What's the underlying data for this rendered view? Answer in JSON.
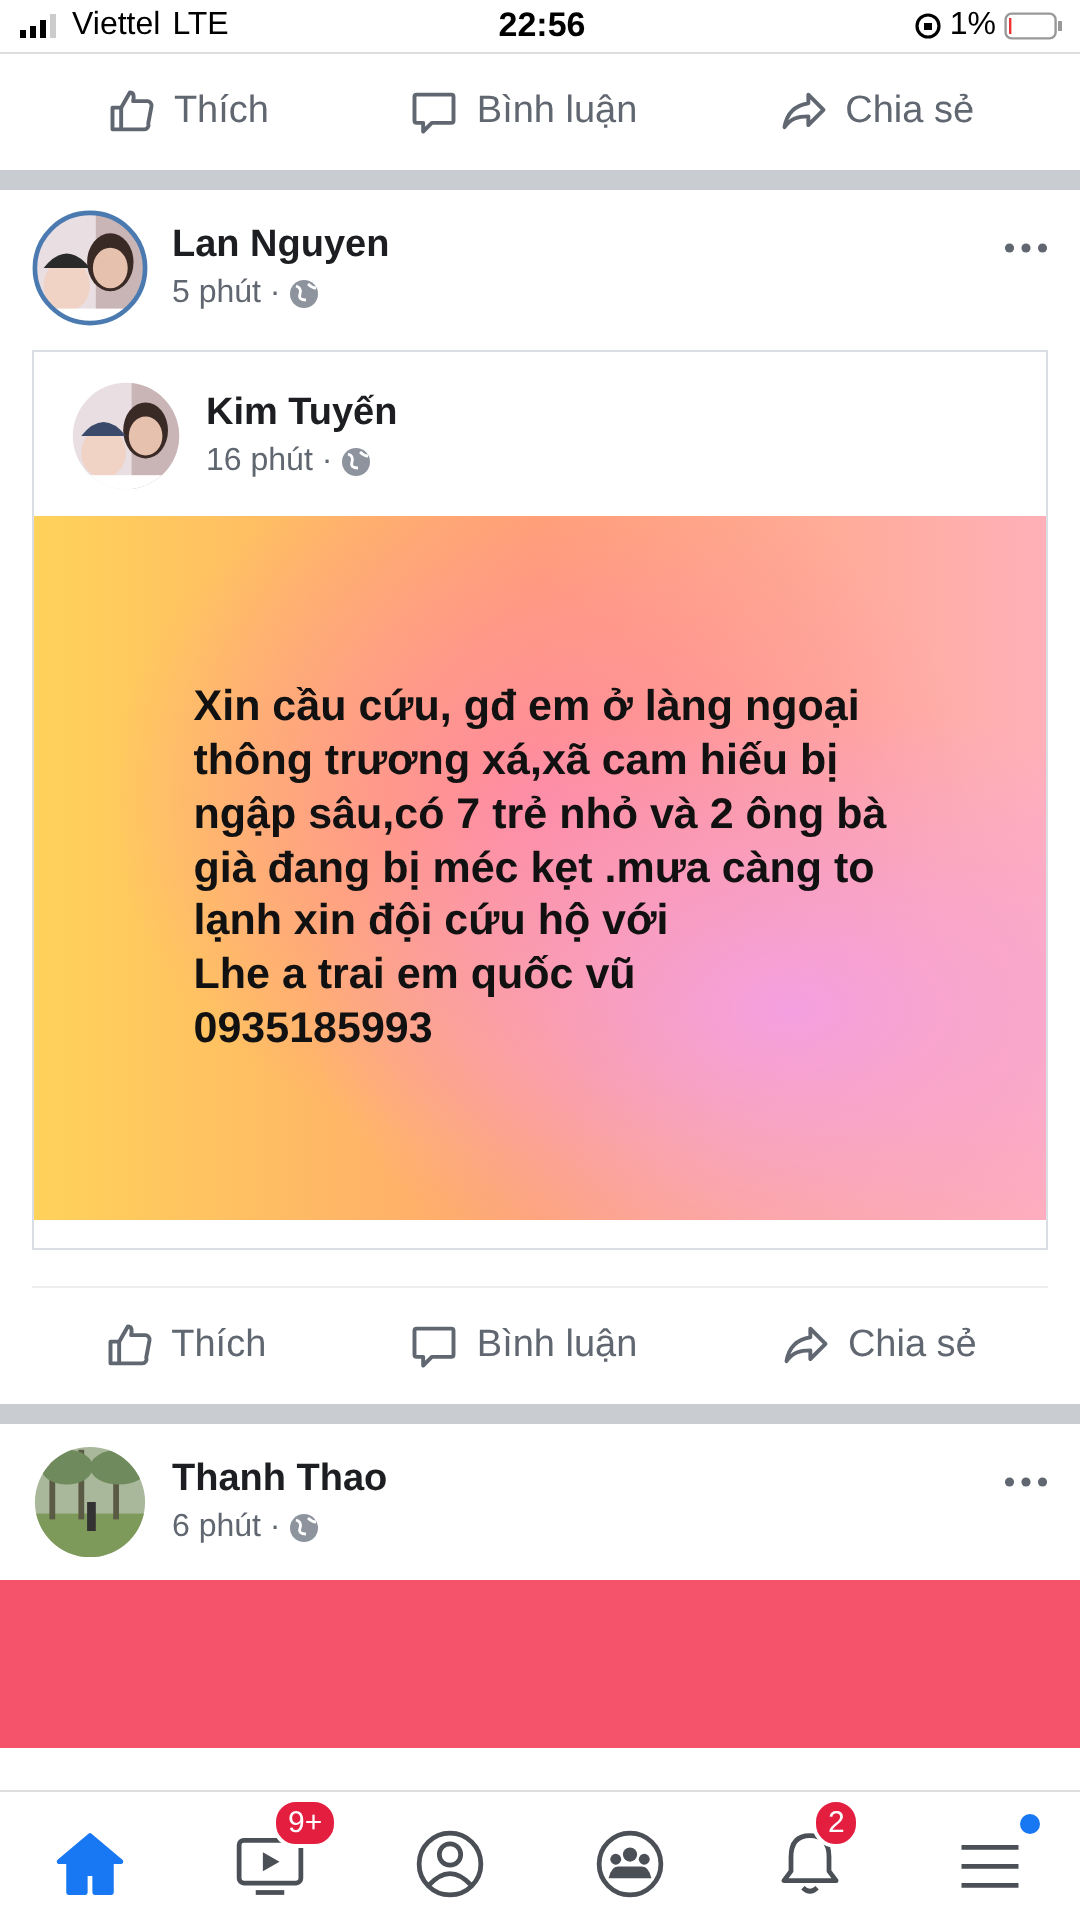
{
  "status_bar": {
    "carrier": "Viettel",
    "network": "LTE",
    "time": "22:56",
    "battery": "1%"
  },
  "previous_post_actions": [
    {
      "kind": "like",
      "label": "Thích"
    },
    {
      "kind": "comment",
      "label": "Bình luận"
    },
    {
      "kind": "share",
      "label": "Chia sẻ"
    }
  ],
  "post": {
    "author": "Lan Nguyen",
    "time": "5 phút ·",
    "shared": {
      "author": "Kim Tuyến",
      "time": "16 phút ·",
      "text_lines": [
        "Xin cầu cứu, gđ em ở làng ngoại",
        "thông trương xá,xã cam hiếu  bị",
        "ngập sâu,có 7 trẻ nhỏ và 2 ông bà",
        "già đang bị méc kẹt .mưa càng to",
        "lạnh xin đội cứu hộ với",
        "Lhe a trai em quốc vũ",
        "0935185993"
      ]
    },
    "actions": [
      {
        "kind": "like",
        "label": "Thích"
      },
      {
        "kind": "comment",
        "label": "Bình luận"
      },
      {
        "kind": "share",
        "label": "Chia sẻ"
      }
    ]
  },
  "next_post": {
    "author": "Thanh Thao",
    "time": "6 phút ·"
  },
  "nav": [
    {
      "kind": "home",
      "selected": true
    },
    {
      "kind": "video",
      "selected": false,
      "badge": "9+"
    },
    {
      "kind": "profile",
      "selected": false
    },
    {
      "kind": "groups",
      "selected": false
    },
    {
      "kind": "notifications",
      "selected": false,
      "badge": "2"
    },
    {
      "kind": "menu",
      "selected": false,
      "dot": true
    }
  ]
}
